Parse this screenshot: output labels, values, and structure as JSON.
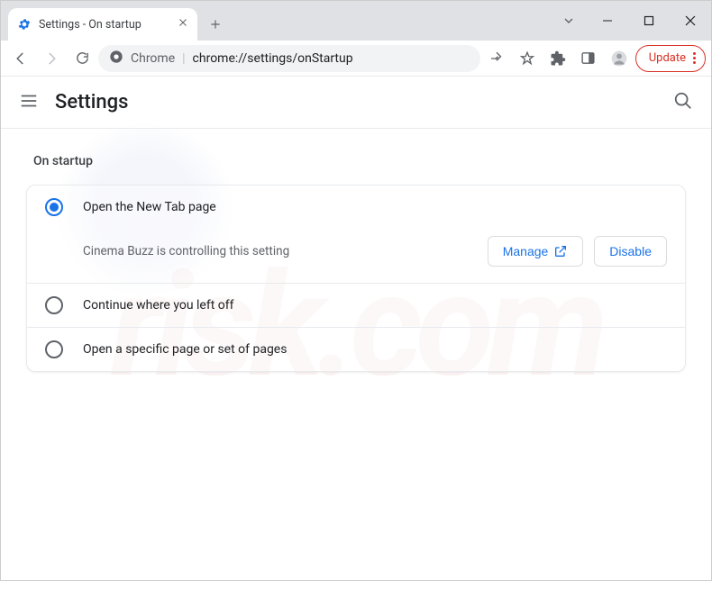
{
  "window": {
    "tab_title": "Settings - On startup"
  },
  "omnibox": {
    "security_label": "Chrome",
    "url": "chrome://settings/onStartup"
  },
  "update_button": {
    "label": "Update"
  },
  "header": {
    "title": "Settings"
  },
  "section": {
    "title": "On startup",
    "options": [
      {
        "label": "Open the New Tab page"
      },
      {
        "label": "Continue where you left off"
      },
      {
        "label": "Open a specific page or set of pages"
      }
    ],
    "controlled_msg": "Cinema Buzz is controlling this setting",
    "manage_label": "Manage",
    "disable_label": "Disable"
  },
  "watermark": {
    "text": "risk.com"
  }
}
